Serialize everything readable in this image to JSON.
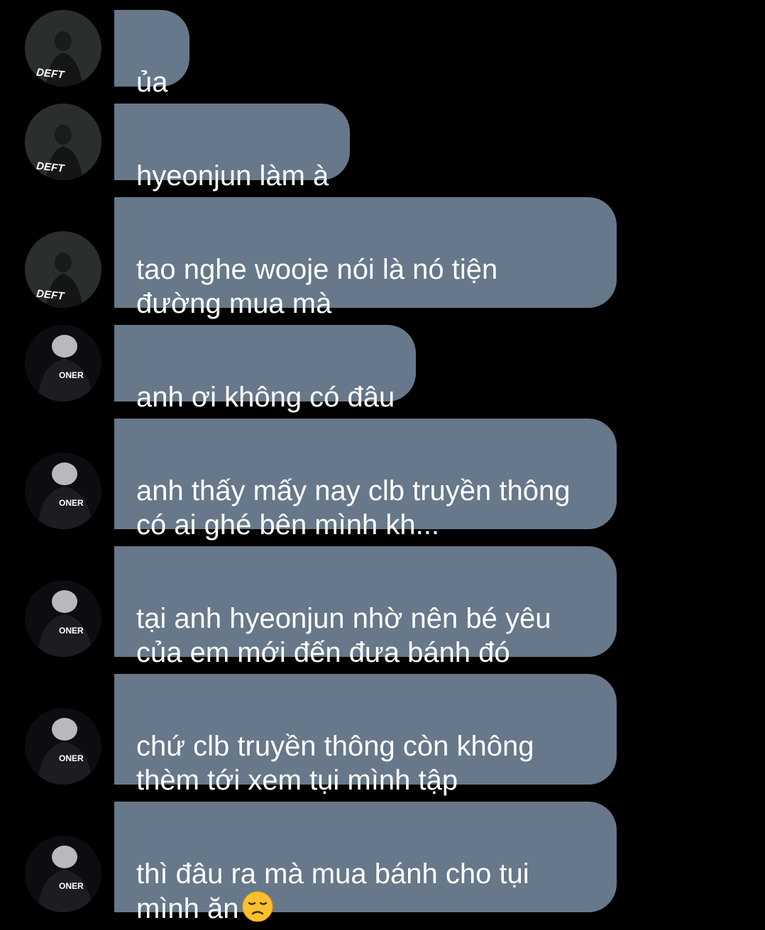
{
  "avatars": {
    "deft": {
      "jersey_text": "DEFT",
      "icon": "avatar-deft-player"
    },
    "oner": {
      "jersey_text": "ONER",
      "icon": "avatar-oner-player"
    }
  },
  "colors": {
    "background": "#000000",
    "bubble": "#66788a",
    "text": "#ffffff"
  },
  "messages": [
    {
      "sender": "deft",
      "text": "ủa"
    },
    {
      "sender": "deft",
      "text": "hyeonjun làm à"
    },
    {
      "sender": "deft",
      "text": "tao nghe wooje nói là nó tiện\nđường mua mà"
    },
    {
      "sender": "oner",
      "text": "anh ơi không có đâu"
    },
    {
      "sender": "oner",
      "text": "anh thấy mấy nay clb truyền thông\ncó ai ghé bên mình kh..."
    },
    {
      "sender": "oner",
      "text": "tại anh hyeonjun nhờ nên bé yêu\ncủa em mới đến đưa bánh đó"
    },
    {
      "sender": "oner",
      "text": "chứ clb truyền thông còn không\nthèm tới xem tụi mình tập"
    },
    {
      "sender": "oner",
      "text": "thì đâu ra mà mua bánh cho tụi\nmình ăn",
      "emoji": "disappointed-face-emoji"
    }
  ]
}
